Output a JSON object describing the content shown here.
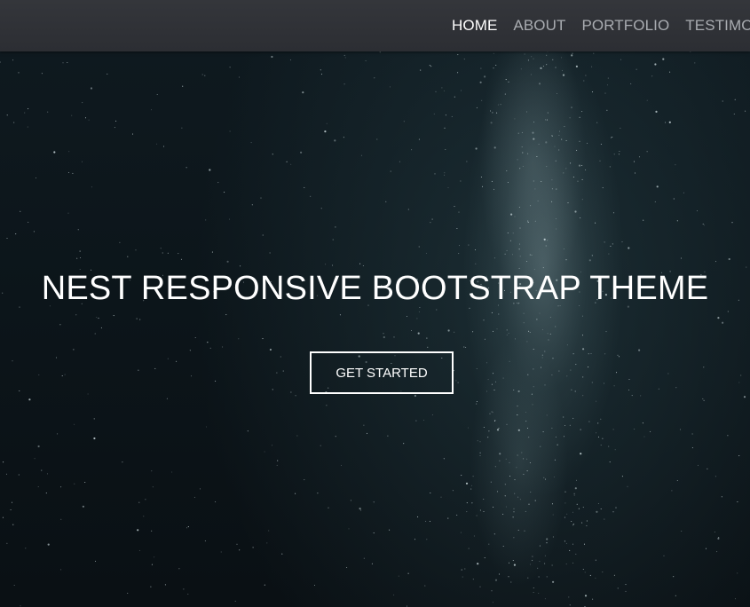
{
  "nav": {
    "items": [
      {
        "label": "HOME",
        "active": true
      },
      {
        "label": "ABOUT",
        "active": false
      },
      {
        "label": "PORTFOLIO",
        "active": false
      },
      {
        "label": "TESTIMONIALS",
        "active": false
      }
    ]
  },
  "hero": {
    "title": "NEST RESPONSIVE BOOTSTRAP THEME",
    "cta_label": "GET STARTED"
  },
  "colors": {
    "navbar_bg": "#2f3136",
    "nav_active": "#ffffff",
    "nav_inactive": "#a9acb1",
    "hero_bg": "#0c151a"
  }
}
